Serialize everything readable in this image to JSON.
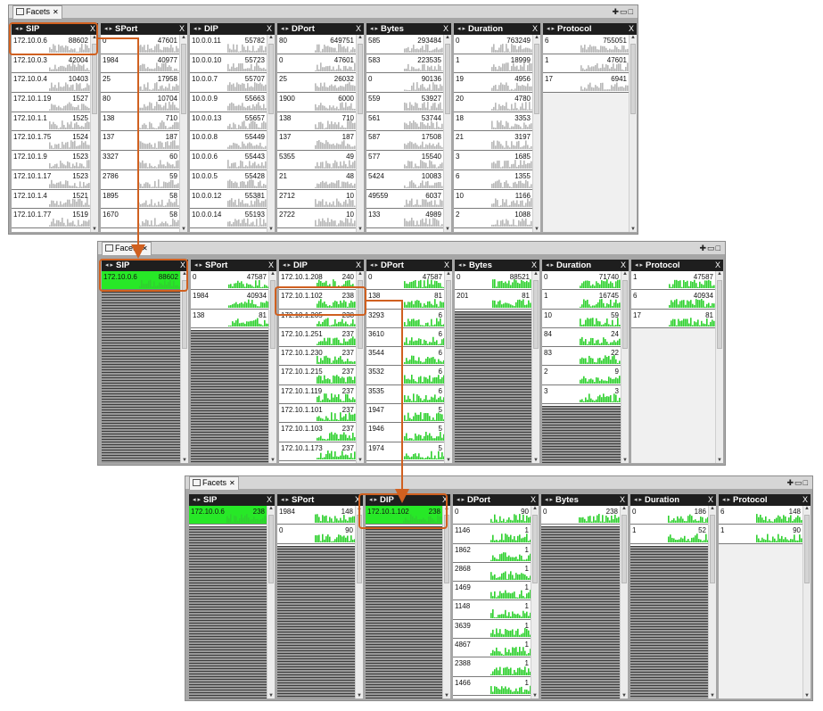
{
  "tab_label": "Facets",
  "colors": {
    "accent": "#d06020",
    "highlight": "#27e827"
  },
  "panels": [
    {
      "columns": [
        {
          "header": "SIP",
          "rows": [
            {
              "key": "172.10.0.6",
              "val": "88602"
            },
            {
              "key": "172.10.0.3",
              "val": "42004"
            },
            {
              "key": "172.10.0.4",
              "val": "10403"
            },
            {
              "key": "172.10.1.19",
              "val": "1527"
            },
            {
              "key": "172.10.1.1",
              "val": "1525"
            },
            {
              "key": "172.10.1.75",
              "val": "1524"
            },
            {
              "key": "172.10.1.9",
              "val": "1523"
            },
            {
              "key": "172.10.1.17",
              "val": "1523"
            },
            {
              "key": "172.10.1.4",
              "val": "1521"
            },
            {
              "key": "172.10.1.77",
              "val": "1519"
            }
          ]
        },
        {
          "header": "SPort",
          "rows": [
            {
              "key": "0",
              "val": "47601"
            },
            {
              "key": "1984",
              "val": "40977"
            },
            {
              "key": "25",
              "val": "17958"
            },
            {
              "key": "80",
              "val": "10704"
            },
            {
              "key": "138",
              "val": "710"
            },
            {
              "key": "137",
              "val": "187"
            },
            {
              "key": "3327",
              "val": "60"
            },
            {
              "key": "2786",
              "val": "59"
            },
            {
              "key": "1895",
              "val": "58"
            },
            {
              "key": "1670",
              "val": "58"
            }
          ]
        },
        {
          "header": "DIP",
          "rows": [
            {
              "key": "10.0.0.11",
              "val": "55782"
            },
            {
              "key": "10.0.0.10",
              "val": "55723"
            },
            {
              "key": "10.0.0.7",
              "val": "55707"
            },
            {
              "key": "10.0.0.9",
              "val": "55663"
            },
            {
              "key": "10.0.0.13",
              "val": "55657"
            },
            {
              "key": "10.0.0.8",
              "val": "55449"
            },
            {
              "key": "10.0.0.6",
              "val": "55443"
            },
            {
              "key": "10.0.0.5",
              "val": "55428"
            },
            {
              "key": "10.0.0.12",
              "val": "55381"
            },
            {
              "key": "10.0.0.14",
              "val": "55193"
            }
          ]
        },
        {
          "header": "DPort",
          "rows": [
            {
              "key": "80",
              "val": "649751"
            },
            {
              "key": "0",
              "val": "47601"
            },
            {
              "key": "25",
              "val": "26032"
            },
            {
              "key": "1900",
              "val": "6000"
            },
            {
              "key": "138",
              "val": "710"
            },
            {
              "key": "137",
              "val": "187"
            },
            {
              "key": "5355",
              "val": "49"
            },
            {
              "key": "21",
              "val": "48"
            },
            {
              "key": "2712",
              "val": "10"
            },
            {
              "key": "2722",
              "val": "10"
            }
          ]
        },
        {
          "header": "Bytes",
          "rows": [
            {
              "key": "585",
              "val": "293484"
            },
            {
              "key": "583",
              "val": "223535"
            },
            {
              "key": "0",
              "val": "90136"
            },
            {
              "key": "559",
              "val": "53927"
            },
            {
              "key": "561",
              "val": "53744"
            },
            {
              "key": "587",
              "val": "17508"
            },
            {
              "key": "577",
              "val": "15540"
            },
            {
              "key": "5424",
              "val": "10083"
            },
            {
              "key": "49559",
              "val": "6037"
            },
            {
              "key": "133",
              "val": "4989"
            }
          ]
        },
        {
          "header": "Duration",
          "rows": [
            {
              "key": "0",
              "val": "763249"
            },
            {
              "key": "1",
              "val": "18999"
            },
            {
              "key": "19",
              "val": "4956"
            },
            {
              "key": "20",
              "val": "4780"
            },
            {
              "key": "18",
              "val": "3353"
            },
            {
              "key": "21",
              "val": "3197"
            },
            {
              "key": "3",
              "val": "1685"
            },
            {
              "key": "6",
              "val": "1355"
            },
            {
              "key": "10",
              "val": "1166"
            },
            {
              "key": "2",
              "val": "1088"
            }
          ]
        },
        {
          "header": "Protocol",
          "rows": [
            {
              "key": "6",
              "val": "755051"
            },
            {
              "key": "1",
              "val": "47601"
            },
            {
              "key": "17",
              "val": "6941"
            }
          ]
        }
      ]
    },
    {
      "columns": [
        {
          "header": "SIP",
          "rows": [
            {
              "key": "172.10.0.6",
              "val": "88602",
              "selected": true
            }
          ]
        },
        {
          "header": "SPort",
          "rows": [
            {
              "key": "0",
              "val": "47587"
            },
            {
              "key": "1984",
              "val": "40934"
            },
            {
              "key": "138",
              "val": "81"
            }
          ]
        },
        {
          "header": "DIP",
          "rows": [
            {
              "key": "172.10.1.208",
              "val": "240"
            },
            {
              "key": "172.10.1.102",
              "val": "238"
            },
            {
              "key": "172.10.1.205",
              "val": "238"
            },
            {
              "key": "172.10.1.251",
              "val": "237"
            },
            {
              "key": "172.10.1.230",
              "val": "237"
            },
            {
              "key": "172.10.1.215",
              "val": "237"
            },
            {
              "key": "172.10.1.119",
              "val": "237"
            },
            {
              "key": "172.10.1.101",
              "val": "237"
            },
            {
              "key": "172.10.1.103",
              "val": "237"
            },
            {
              "key": "172.10.1.173",
              "val": "237"
            }
          ]
        },
        {
          "header": "DPort",
          "rows": [
            {
              "key": "0",
              "val": "47587"
            },
            {
              "key": "138",
              "val": "81"
            },
            {
              "key": "3293",
              "val": "6"
            },
            {
              "key": "3610",
              "val": "6"
            },
            {
              "key": "3544",
              "val": "6"
            },
            {
              "key": "3532",
              "val": "6"
            },
            {
              "key": "3535",
              "val": "6"
            },
            {
              "key": "1947",
              "val": "5"
            },
            {
              "key": "1946",
              "val": "5"
            },
            {
              "key": "1974",
              "val": "5"
            }
          ]
        },
        {
          "header": "Bytes",
          "rows": [
            {
              "key": "0",
              "val": "88521"
            },
            {
              "key": "201",
              "val": "81"
            }
          ]
        },
        {
          "header": "Duration",
          "rows": [
            {
              "key": "0",
              "val": "71740"
            },
            {
              "key": "1",
              "val": "16745"
            },
            {
              "key": "10",
              "val": "59"
            },
            {
              "key": "84",
              "val": "24"
            },
            {
              "key": "83",
              "val": "22"
            },
            {
              "key": "2",
              "val": "9"
            },
            {
              "key": "3",
              "val": "3"
            }
          ]
        },
        {
          "header": "Protocol",
          "rows": [
            {
              "key": "1",
              "val": "47587"
            },
            {
              "key": "6",
              "val": "40934"
            },
            {
              "key": "17",
              "val": "81"
            }
          ]
        }
      ]
    },
    {
      "columns": [
        {
          "header": "SIP",
          "rows": [
            {
              "key": "172.10.0.6",
              "val": "238",
              "selected": true
            }
          ]
        },
        {
          "header": "SPort",
          "rows": [
            {
              "key": "1984",
              "val": "148"
            },
            {
              "key": "0",
              "val": "90"
            }
          ]
        },
        {
          "header": "DIP",
          "rows": [
            {
              "key": "172.10.1.102",
              "val": "238",
              "selected": true
            }
          ]
        },
        {
          "header": "DPort",
          "rows": [
            {
              "key": "0",
              "val": "90"
            },
            {
              "key": "1146",
              "val": "1"
            },
            {
              "key": "1862",
              "val": "1"
            },
            {
              "key": "2868",
              "val": "1"
            },
            {
              "key": "1469",
              "val": "1"
            },
            {
              "key": "1148",
              "val": "1"
            },
            {
              "key": "3639",
              "val": "1"
            },
            {
              "key": "4867",
              "val": "1"
            },
            {
              "key": "2388",
              "val": "1"
            },
            {
              "key": "1466",
              "val": "1"
            }
          ]
        },
        {
          "header": "Bytes",
          "rows": [
            {
              "key": "0",
              "val": "238"
            }
          ]
        },
        {
          "header": "Duration",
          "rows": [
            {
              "key": "0",
              "val": "186"
            },
            {
              "key": "1",
              "val": "52"
            }
          ]
        },
        {
          "header": "Protocol",
          "rows": [
            {
              "key": "6",
              "val": "148"
            },
            {
              "key": "1",
              "val": "90"
            }
          ]
        }
      ]
    }
  ]
}
